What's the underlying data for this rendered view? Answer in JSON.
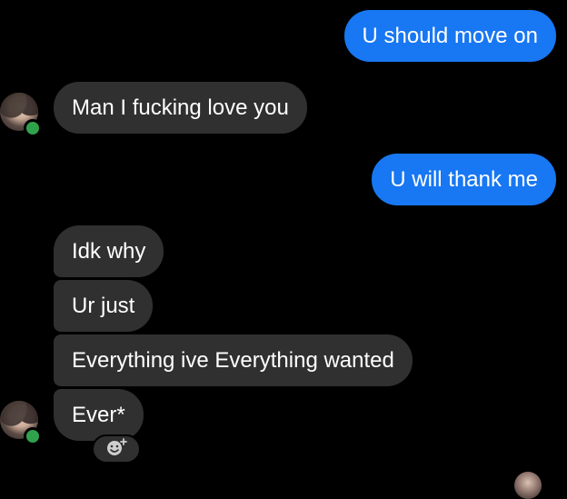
{
  "conversation": {
    "messages": [
      {
        "direction": "outgoing",
        "text": "U should move on"
      },
      {
        "direction": "incoming",
        "text": "Man I fucking love you"
      },
      {
        "direction": "outgoing",
        "text": "U will thank me"
      },
      {
        "direction": "incoming",
        "text": "Idk why"
      },
      {
        "direction": "incoming",
        "text": "Ur just"
      },
      {
        "direction": "incoming",
        "text": "Everything ive Everything wanted"
      },
      {
        "direction": "incoming",
        "text": "Ever*"
      }
    ]
  },
  "contact": {
    "online": true
  },
  "icons": {
    "avatar": "contact-avatar",
    "presence": "online-indicator",
    "reaction": "add-reaction-icon"
  },
  "colors": {
    "background": "#000000",
    "outgoing_bubble": "#1877f2",
    "incoming_bubble": "#303030",
    "text": "#ffffff",
    "online": "#31a24c"
  }
}
